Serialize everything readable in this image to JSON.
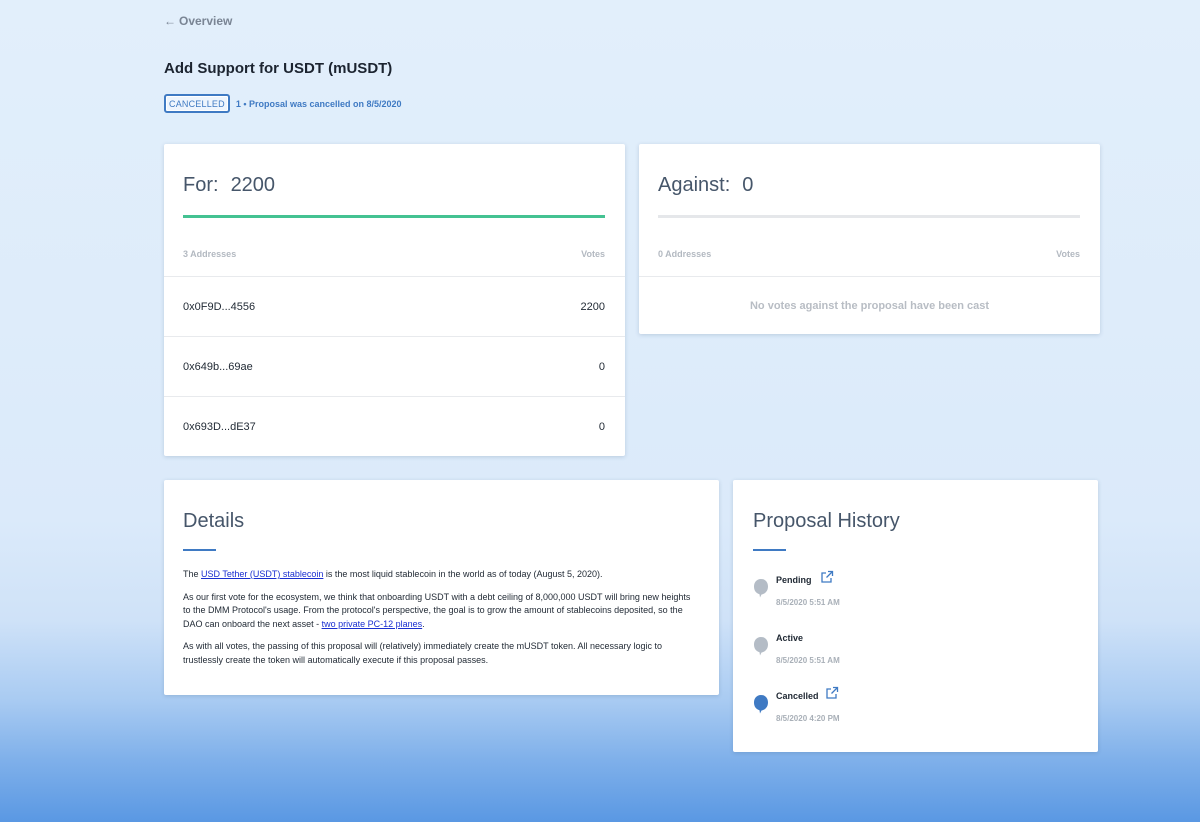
{
  "nav": {
    "back_arrow": "←",
    "back_label": "Overview"
  },
  "proposal": {
    "title": "Add Support for USDT (mUSDT)",
    "status_badge": "CANCELLED",
    "status_text": "1 • Proposal was cancelled on 8/5/2020"
  },
  "for": {
    "label": "For:",
    "total": "2200",
    "progress_fraction": 1.0,
    "addresses_label": "3 Addresses",
    "votes_label": "Votes",
    "rows": [
      {
        "address": "0x0F9D...4556",
        "votes": "2200"
      },
      {
        "address": "0x649b...69ae",
        "votes": "0"
      },
      {
        "address": "0x693D...dE37",
        "votes": "0"
      }
    ]
  },
  "against": {
    "label": "Against:",
    "total": "0",
    "progress_fraction": 0,
    "addresses_label": "0 Addresses",
    "votes_label": "Votes",
    "empty_message": "No votes against the proposal have been cast"
  },
  "details": {
    "title": "Details",
    "p1_before": "The ",
    "p1_link": "USD Tether (USDT) stablecoin",
    "p1_after": " is the most liquid stablecoin in the world as of today (August 5, 2020).",
    "p2_before": "As our first vote for the ecosystem, we think that onboarding USDT with a debt ceiling of 8,000,000 USDT will bring new heights to the DMM Protocol's usage. From the protocol's perspective, the goal is to grow the amount of stablecoins deposited, so the DAO can onboard the next asset - ",
    "p2_link": "two private PC-12 planes",
    "p2_after": ".",
    "p3": "As with all votes, the passing of this proposal will (relatively) immediately create the mUSDT token. All necessary logic to trustlessly create the token will automatically execute if this proposal passes."
  },
  "history": {
    "title": "Proposal History",
    "items": [
      {
        "label": "Pending",
        "date": "8/5/2020 5:51 AM",
        "dot_color": "#b4bcc6",
        "has_link": true,
        "icon": "external-link-icon"
      },
      {
        "label": "Active",
        "date": "8/5/2020 5:51 AM",
        "dot_color": "#b4bcc6",
        "has_link": false
      },
      {
        "label": "Cancelled",
        "date": "8/5/2020 4:20 PM",
        "dot_color": "#3f7ac3",
        "has_link": true,
        "icon": "external-link-icon"
      }
    ]
  },
  "colors": {
    "accent": "#3f7ac3",
    "for_bar": "#44c292",
    "link": "#1a2fd0"
  }
}
